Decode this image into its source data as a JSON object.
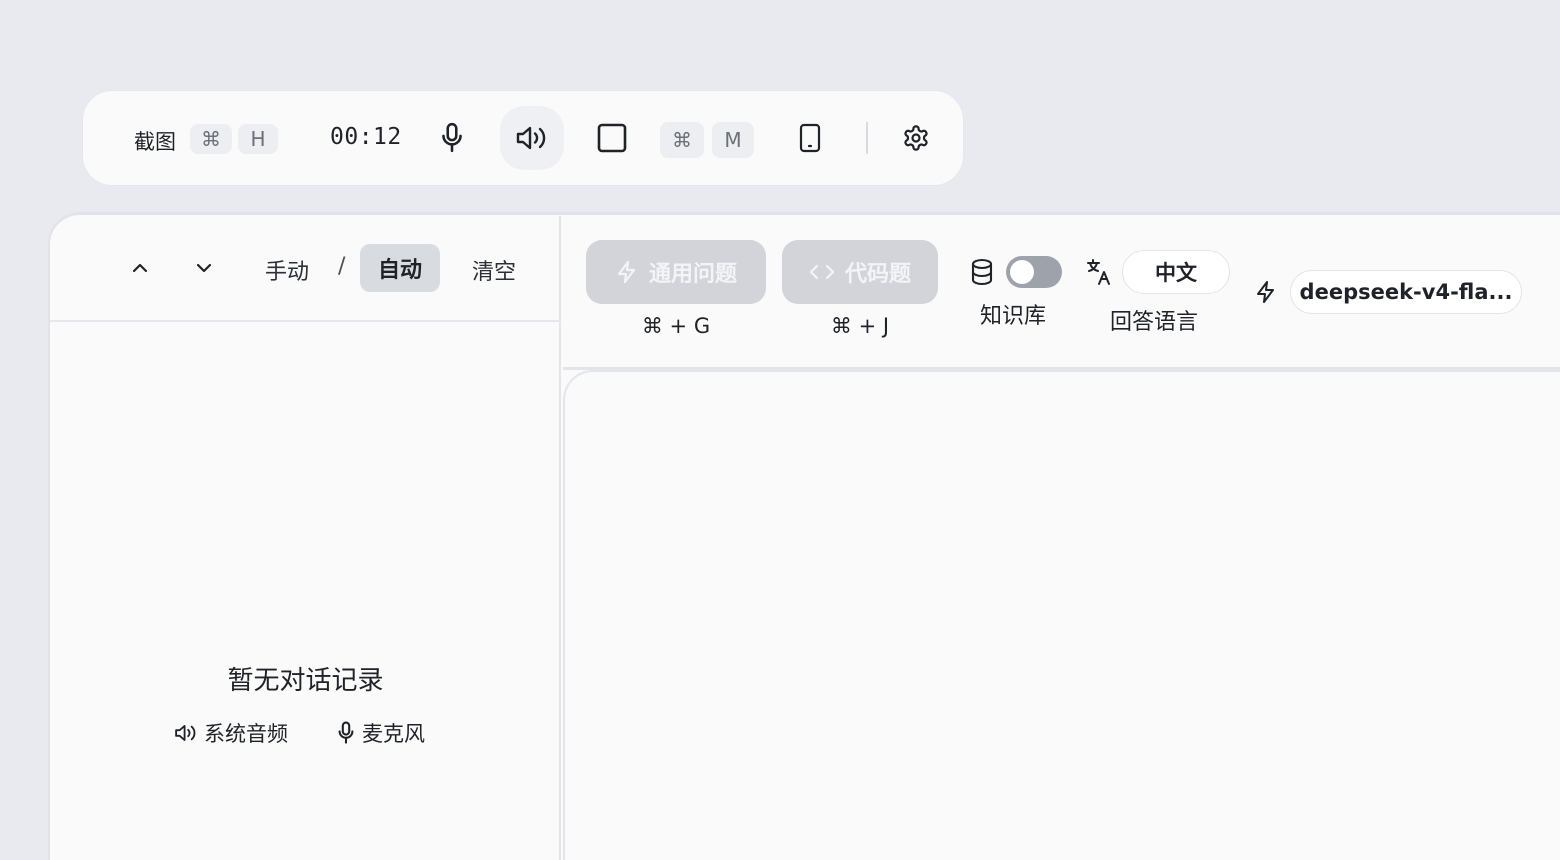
{
  "toolbar": {
    "screenshot_label": "截图",
    "screenshot_key_mod": "⌘",
    "screenshot_key": "H",
    "timer": "00:12",
    "mode_key_mod": "⌘",
    "mode_key": "M",
    "icons": [
      "microphone-icon",
      "speaker-icon",
      "square-icon",
      "phone-icon",
      "gear-icon"
    ]
  },
  "left_panel": {
    "mode_manual": "手动",
    "mode_separator": "/",
    "mode_auto": "自动",
    "clear_label": "清空",
    "empty_title": "暂无对话记录",
    "source_system_audio": "系统音频",
    "source_microphone": "麦克风"
  },
  "right_header": {
    "general_question_label": "通用问题",
    "general_question_shortcut": "⌘ + G",
    "code_question_label": "代码题",
    "code_question_shortcut": "⌘ + J",
    "knowledge_base_label": "知识库",
    "knowledge_base_enabled": false,
    "answer_language_value": "中文",
    "answer_language_label": "回答语言",
    "model_name": "deepseek-v4-fla..."
  },
  "colors": {
    "background": "#e8eaef",
    "panel": "#fafafa",
    "disabled_button": "#d2d4d9",
    "toggle_off": "#9ea2ab",
    "active_mode": "#d8dbe0"
  }
}
